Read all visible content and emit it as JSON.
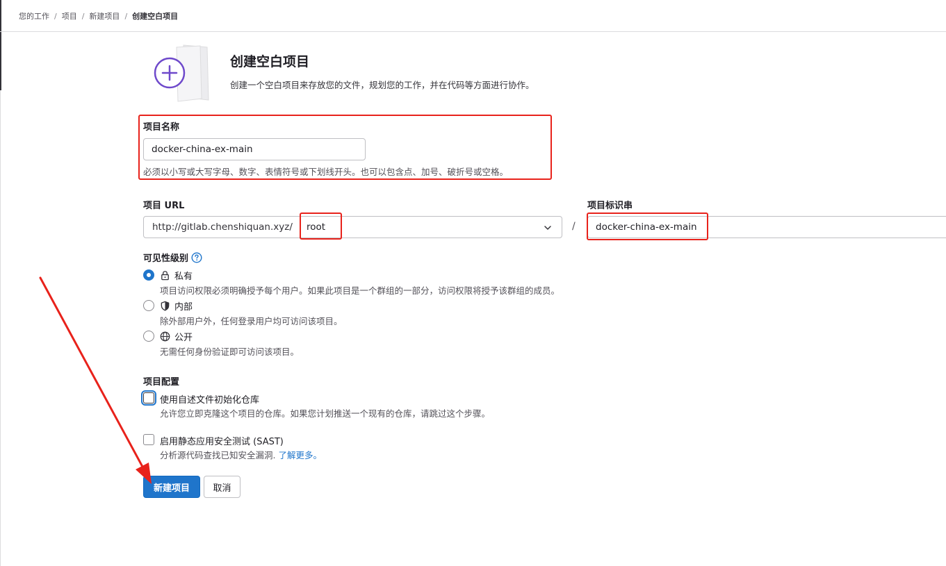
{
  "breadcrumb": {
    "items": [
      "您的工作",
      "项目",
      "新建项目",
      "创建空白项目"
    ],
    "separator": "/"
  },
  "header": {
    "title": "创建空白项目",
    "description": "创建一个空白项目来存放您的文件，规划您的工作，并在代码等方面进行协作。"
  },
  "project_name": {
    "label": "项目名称",
    "value": "docker-china-ex-main",
    "help": "必须以小写或大写字母、数字、表情符号或下划线开头。也可以包含点、加号、破折号或空格。"
  },
  "project_url": {
    "label": "项目 URL",
    "prefix": "http://gitlab.chenshiquan.xyz/",
    "namespace": "root",
    "separator": "/"
  },
  "project_slug": {
    "label": "项目标识串",
    "value": "docker-china-ex-main"
  },
  "visibility": {
    "label": "可见性级别",
    "options": [
      {
        "label": "私有",
        "icon": "lock-icon",
        "description": "项目访问权限必须明确授予每个用户。如果此项目是一个群组的一部分，访问权限将授予该群组的成员。",
        "checked": true
      },
      {
        "label": "内部",
        "icon": "shield-icon",
        "description": "除外部用户外，任何登录用户均可访问该项目。",
        "checked": false
      },
      {
        "label": "公开",
        "icon": "globe-icon",
        "description": "无需任何身份验证即可访问该项目。",
        "checked": false
      }
    ]
  },
  "project_config": {
    "label": "项目配置",
    "options": [
      {
        "label": "使用自述文件初始化仓库",
        "description": "允许您立即克隆这个项目的仓库。如果您计划推送一个现有的仓库，请跳过这个步骤。",
        "checked": false
      },
      {
        "label": "启用静态应用安全测试 (SAST)",
        "description": "分析源代码查找已知安全漏洞.",
        "link": "了解更多。",
        "checked": false
      }
    ]
  },
  "actions": {
    "create": "新建项目",
    "cancel": "取消"
  },
  "colors": {
    "accent": "#1f75cb",
    "annotation": "#e8221b",
    "illustration": "#6e49cb"
  }
}
